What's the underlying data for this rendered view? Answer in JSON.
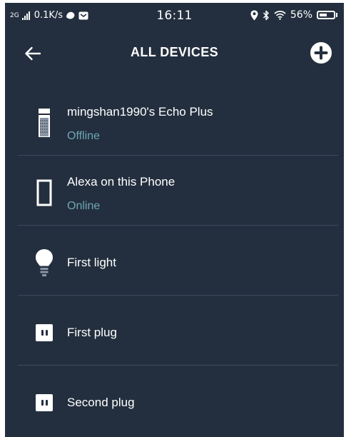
{
  "status_bar": {
    "network": "2G",
    "speed": "0.1K/s",
    "time": "16:11",
    "battery": "56%"
  },
  "header": {
    "title": "ALL DEVICES"
  },
  "devices": [
    {
      "name": "mingshan1990's Echo Plus",
      "status": "Offline",
      "icon": "echo-plus-icon"
    },
    {
      "name": "Alexa on this Phone",
      "status": "Online",
      "icon": "phone-device-icon"
    },
    {
      "name": "First light",
      "icon": "light-bulb-icon"
    },
    {
      "name": "First plug",
      "icon": "plug-icon"
    },
    {
      "name": "Second plug",
      "icon": "plug-icon"
    }
  ],
  "colors": {
    "background": "#232f3e",
    "status_text": "#6fa6b6",
    "divider": "#3b4a5c"
  }
}
